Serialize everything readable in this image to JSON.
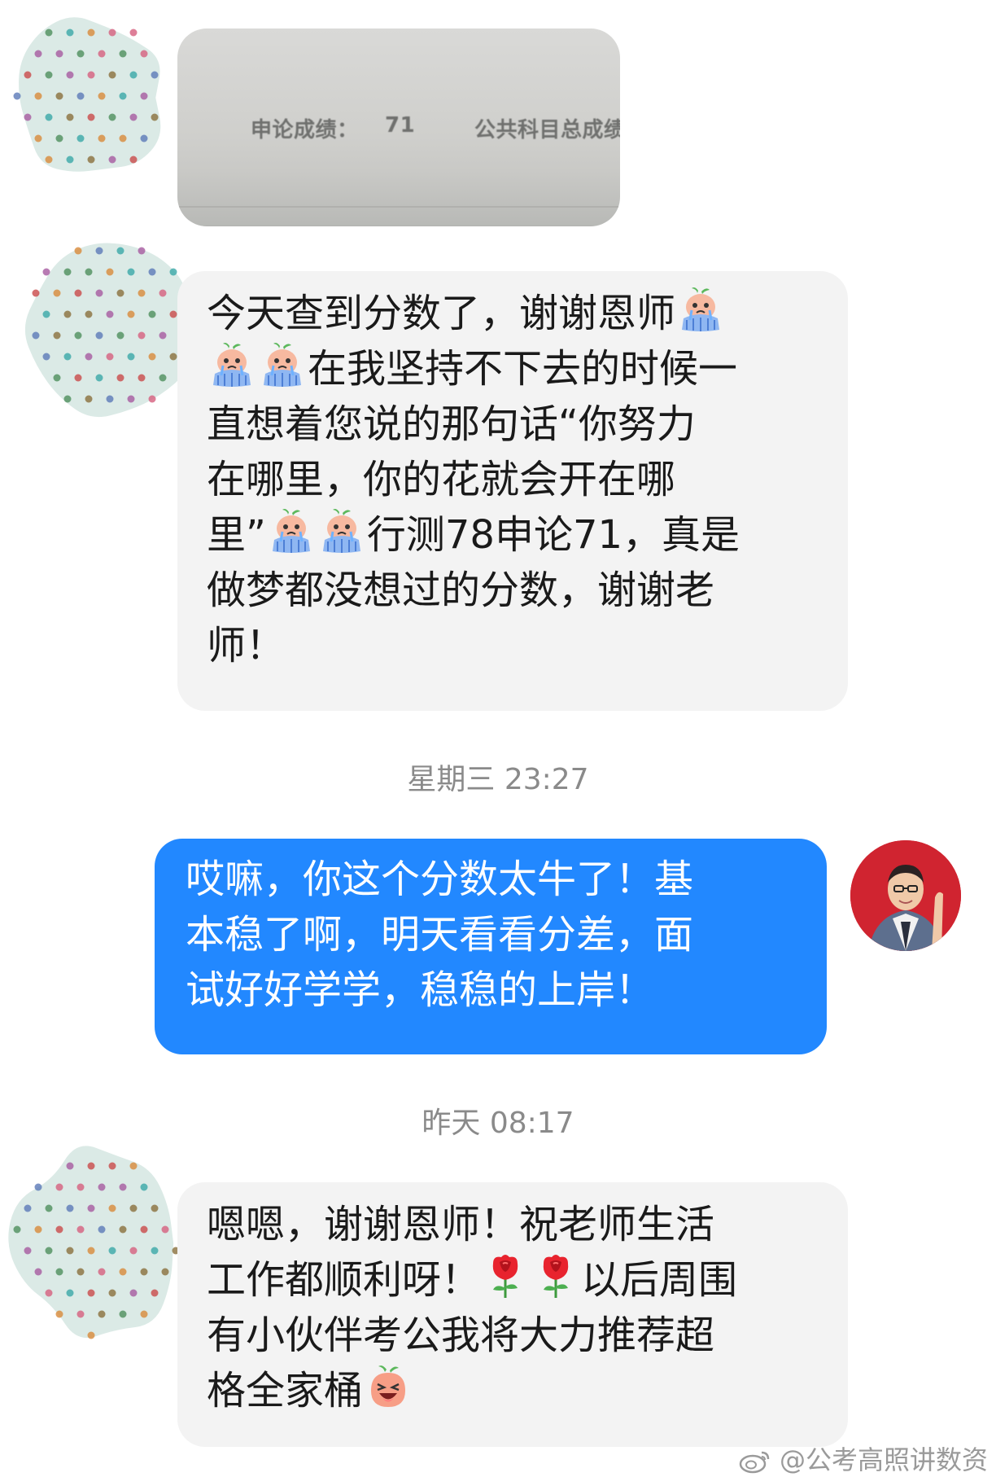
{
  "photo": {
    "label1": "申论成绩：",
    "score": "71",
    "label2": "公共科目总成绩"
  },
  "messages": [
    {
      "lines": [
        "今天查到分数了，谢谢恩师",
        "在我坚持不下去的时候一",
        "直想着您说的那句话“你努力",
        "在哪里，你的花就会开在哪",
        "里”",
        "行测78申论71，真是",
        "做梦都没想过的分数，谢谢老",
        "师！"
      ]
    },
    {
      "lines": [
        "哎嘛，你这个分数太牛了！基",
        "本稳了啊，明天看看分差，面",
        "试好好学学，稳稳的上岸！"
      ]
    },
    {
      "lines": [
        "嗯嗯，谢谢恩师！祝老师生活",
        "工作都顺利呀！",
        "以后周围",
        "有小伙伴考公我将大力推荐超",
        "格全家桶"
      ]
    }
  ],
  "timestamps": {
    "t1": "星期三 23:27",
    "t2": "昨天 08:17"
  },
  "watermark": "@公考高照讲数资",
  "icons": {
    "crying": "crying-emoji-icon",
    "rose": "rose-emoji-icon",
    "laughing": "laughing-emoji-icon",
    "weibo": "weibo-icon"
  },
  "colors": {
    "incoming_bubble": "#f3f3f3",
    "outgoing_bubble": "#2288ff",
    "timestamp_text": "#8a8a8a"
  }
}
